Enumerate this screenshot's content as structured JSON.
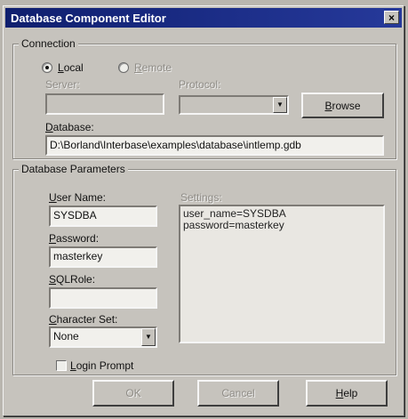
{
  "window": {
    "title": "Database Component Editor",
    "close_glyph": "×"
  },
  "connection": {
    "group_title": "Connection",
    "local_label": "Local",
    "remote_label": "Remote",
    "selected": "Local",
    "server_label": "Server:",
    "server_value": "",
    "protocol_label": "Protocol:",
    "protocol_value": "",
    "browse_label": "Browse",
    "database_label": "Database:",
    "database_value": "D:\\Borland\\Interbase\\examples\\database\\intlemp.gdb"
  },
  "parameters": {
    "group_title": "Database Parameters",
    "username_label": "User Name:",
    "username_value": "SYSDBA",
    "password_label": "Password:",
    "password_value": "masterkey",
    "sqlrole_label": "SQLRole:",
    "sqlrole_value": "",
    "charset_label": "Character Set:",
    "charset_value": "None",
    "settings_label": "Settings:",
    "settings_lines": [
      "user_name=SYSDBA",
      "password=masterkey"
    ],
    "login_prompt_label": "Login Prompt",
    "login_prompt_checked": false
  },
  "footer": {
    "ok_label": "OK",
    "cancel_label": "Cancel",
    "help_label": "Help"
  },
  "icons": {
    "dropdown": "chevron-down-icon",
    "close": "close-icon"
  },
  "colors": {
    "titlebar": "#1d2f8a",
    "face": "#c6c3bd"
  }
}
